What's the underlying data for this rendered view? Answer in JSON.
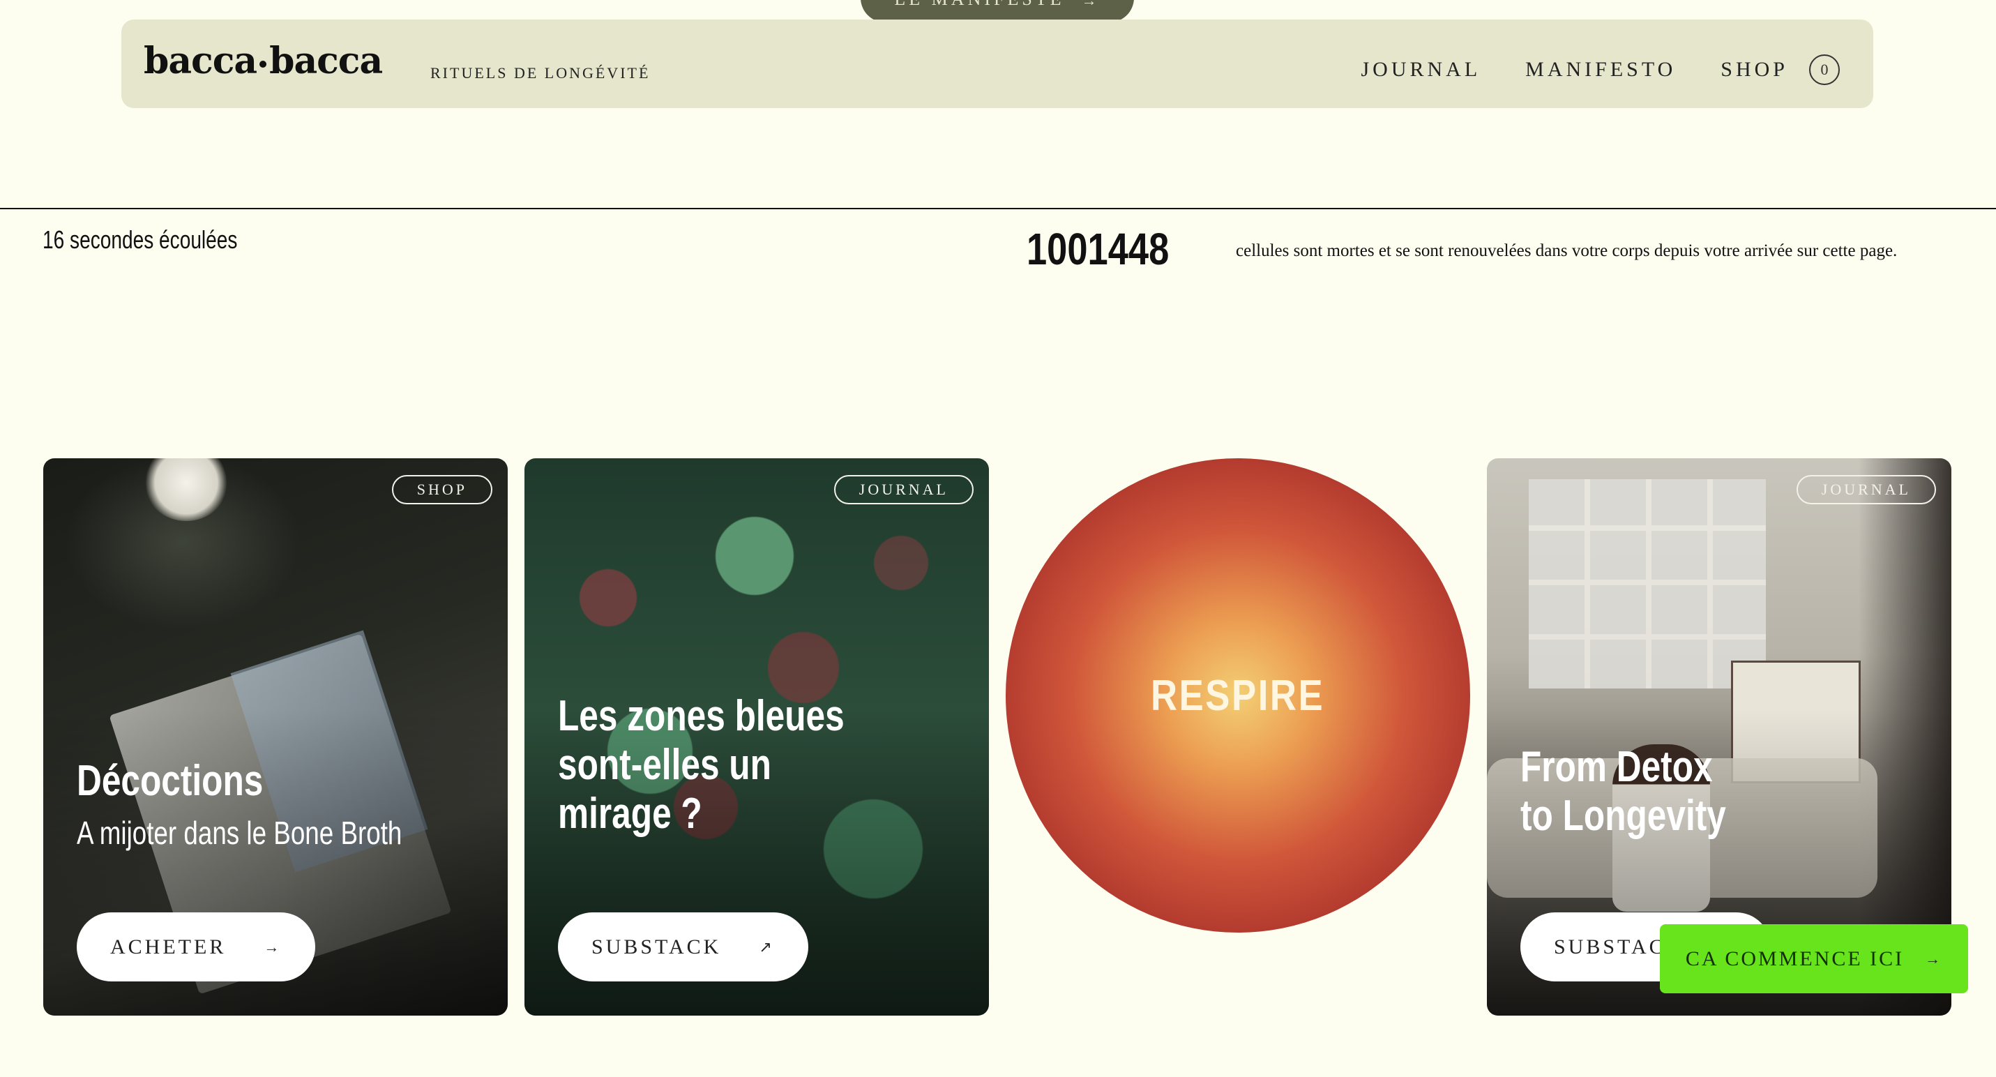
{
  "top_pill": {
    "label": "LE MANIFESTE",
    "arrow": "→"
  },
  "header": {
    "logo_left": "bacca",
    "logo_right": "bacca",
    "tagline": "RITUELS DE LONGÉVITÉ",
    "nav": [
      "JOURNAL",
      "MANIFESTO",
      "SHOP"
    ],
    "cart_count": "0"
  },
  "timer": {
    "elapsed": "16 secondes écoulées",
    "cell_count": "1001448",
    "cell_text": "cellules sont mortes et se sont renouvelées dans votre corps depuis votre arrivée sur cette page."
  },
  "cards": [
    {
      "badge": "SHOP",
      "title": "Décoctions",
      "subtitle": "A mijoter dans le Bone Broth",
      "button": "ACHETER",
      "button_icon": "→"
    },
    {
      "badge": "JOURNAL",
      "title": "Les zones bleues sont-elles un mirage ?",
      "button": "SUBSTACK",
      "button_icon": "↗"
    },
    {
      "badge": "JOURNAL",
      "title": "From Detox to Longevity",
      "button": "SUBSTACK",
      "button_icon": "↗"
    }
  ],
  "respire": {
    "label": "RESPIRE",
    "colors": [
      "#f3cf74",
      "#d0573a",
      "#7e1f1f"
    ]
  },
  "cta": {
    "label": "CA COMMENCE ICI",
    "arrow": "→",
    "color": "#68e41c"
  }
}
